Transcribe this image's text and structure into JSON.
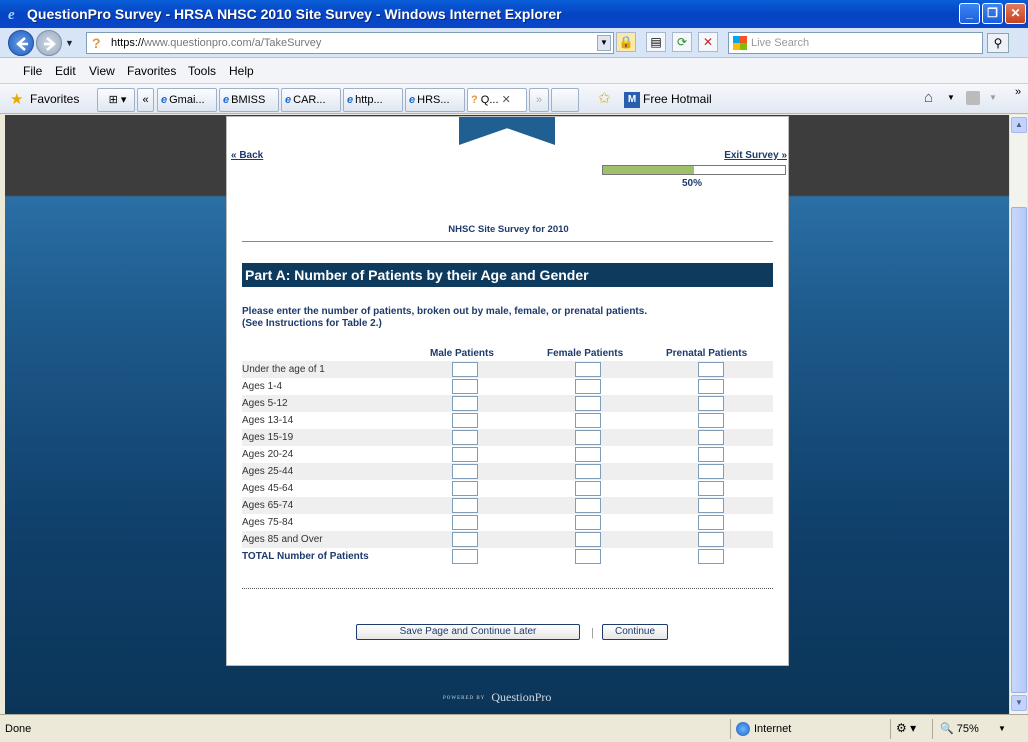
{
  "window": {
    "title": "QuestionPro Survey - HRSA NHSC 2010 Site Survey - Windows Internet Explorer",
    "minimize": "_",
    "maximize": "❐",
    "close": "✕"
  },
  "address_bar": {
    "url_scheme": "https://",
    "url_host": "www.questionpro.com",
    "url_path": "/a/TakeSurvey"
  },
  "search": {
    "placeholder": "Live Search"
  },
  "menu": {
    "items": [
      "File",
      "Edit",
      "View",
      "Favorites",
      "Tools",
      "Help"
    ]
  },
  "favorites_bar": {
    "label": "Favorites",
    "tabs": [
      "Gmai...",
      "BMISS",
      "CAR...",
      "http...",
      "HRS...",
      "Q..."
    ],
    "hotmail": "Free Hotmail"
  },
  "survey": {
    "back_label": "«  Back",
    "exit_label": "Exit Survey  »",
    "progress_percent": 50,
    "progress_label": "50%",
    "survey_title": "NHSC Site Survey for 2010",
    "section_title": "Part A: Number of Patients by their Age and Gender",
    "instructions_line1": "Please enter the number of patients, broken out by male, female, or prenatal patients.",
    "instructions_line2": "(See Instructions for Table 2.)",
    "columns": [
      "Male Patients",
      "Female Patients",
      "Prenatal Patients"
    ],
    "rows": [
      "Under the age of 1",
      "Ages 1-4",
      "Ages 5-12",
      "Ages 13-14",
      "Ages 15-19",
      "Ages 20-24",
      "Ages 25-44",
      "Ages 45-64",
      "Ages 65-74",
      "Ages 75-84",
      "Ages 85 and Over",
      "TOTAL Number of Patients"
    ],
    "save_button": "Save Page and Continue Later",
    "continue_button": "Continue",
    "powered_by_small": "POWERED BY",
    "powered_by_brand": "QuestionPro"
  },
  "status_bar": {
    "status": "Done",
    "zone": "Internet",
    "zoom": "75%"
  },
  "colors": {
    "section_header_bg": "#0e3a5d",
    "progress_fill": "#9ec06b",
    "ie_titlebar": "#0544c4"
  }
}
